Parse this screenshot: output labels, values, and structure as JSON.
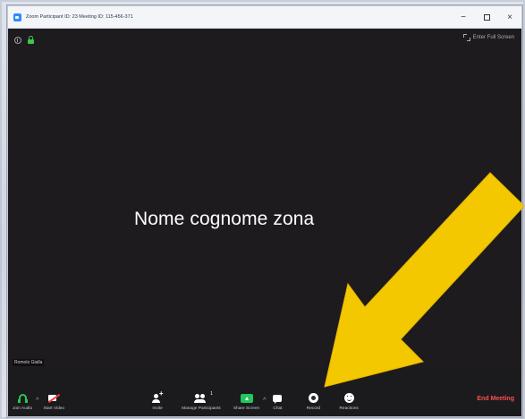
{
  "window": {
    "title": "Zoom Participant ID: 23   Meeting ID: 115-456-371",
    "minimize_label": "−",
    "close_label": "×"
  },
  "video": {
    "fullscreen_label": "Enter Full Screen",
    "participant_name": "Nome cognome zona",
    "name_tag": "Romolo Gialla"
  },
  "toolbar": {
    "join_audio": "Join Audio",
    "start_video": "Start Video",
    "invite": "Invite",
    "manage_participants": "Manage Participants",
    "participants_count": "1",
    "share_screen": "Share Screen",
    "chat": "Chat",
    "record": "Record",
    "reactions": "Reactions",
    "end_meeting": "End Meeting",
    "caret": "^"
  },
  "colors": {
    "zoom_blue": "#2d8cff",
    "end_meeting_red": "#ff4d4d",
    "share_green": "#22c55e",
    "arrow_yellow": "#f4c800",
    "video_off_red": "#ef3b3b"
  },
  "icons": {
    "app": "zoom-app-icon",
    "info": "info-icon",
    "lock": "lock-icon",
    "fullscreen": "fullscreen-icon",
    "audio": "headphone-icon",
    "video": "video-off-icon",
    "invite": "invite-icon",
    "participants": "participants-icon",
    "share": "share-screen-icon",
    "chat": "chat-icon",
    "record": "record-icon",
    "reactions": "reactions-icon",
    "annotation_arrow": "yellow-arrow-icon"
  }
}
